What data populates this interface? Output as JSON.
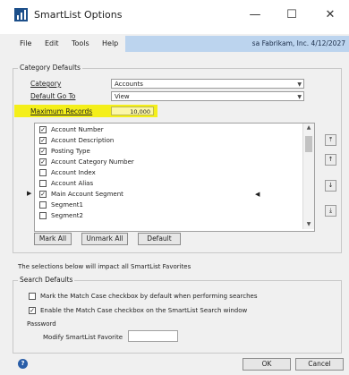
{
  "window": {
    "title": "SmartList Options",
    "minimize_glyph": "—",
    "maximize_glyph": "☐",
    "close_glyph": "✕"
  },
  "menubar": {
    "items": [
      "File",
      "Edit",
      "Tools",
      "Help"
    ],
    "company_info": "sa  Fabrikam, Inc.  4/12/2027"
  },
  "category_defaults": {
    "group_title": "Category Defaults",
    "category_label": "Category",
    "category_value": "Accounts",
    "default_go_to_label": "Default Go To",
    "default_go_to_value": "View",
    "maximum_records_label": "Maximum Records",
    "maximum_records_value": "10,000",
    "columns": [
      {
        "label": "Account Number",
        "checked": true,
        "pointer": false
      },
      {
        "label": "Account Description",
        "checked": true,
        "pointer": false
      },
      {
        "label": "Posting Type",
        "checked": true,
        "pointer": false
      },
      {
        "label": "Account Category Number",
        "checked": true,
        "pointer": false
      },
      {
        "label": "Account Index",
        "checked": false,
        "pointer": false
      },
      {
        "label": "Account Alias",
        "checked": false,
        "pointer": false
      },
      {
        "label": "Main Account Segment",
        "checked": true,
        "pointer": true
      },
      {
        "label": "Segment1",
        "checked": false,
        "pointer": false
      },
      {
        "label": "Segment2",
        "checked": false,
        "pointer": false
      }
    ],
    "side_buttons": [
      "⤒",
      "↑",
      "↓",
      "⤓"
    ],
    "mark_all_label": "Mark All",
    "unmark_all_label": "Unmark All",
    "default_label": "Default"
  },
  "note_text": "The selections below will impact all SmartList Favorites",
  "search_defaults": {
    "group_title": "Search Defaults",
    "match_case_label": "Mark the Match Case checkbox by default when performing searches",
    "match_case_checked": false,
    "enable_match_case_label": "Enable the Match Case checkbox on the SmartList Search window",
    "enable_match_case_checked": true
  },
  "password": {
    "label": "Password",
    "modify_favorite_label": "Modify SmartList Favorite",
    "modify_favorite_value": ""
  },
  "footer": {
    "help_glyph": "?",
    "ok_label": "OK",
    "cancel_label": "Cancel"
  },
  "colors": {
    "highlight": "#f4ef1a",
    "company_strip": "#bcd4ee",
    "app_icon": "#1c4f8a",
    "help_icon": "#2a5ea8"
  }
}
